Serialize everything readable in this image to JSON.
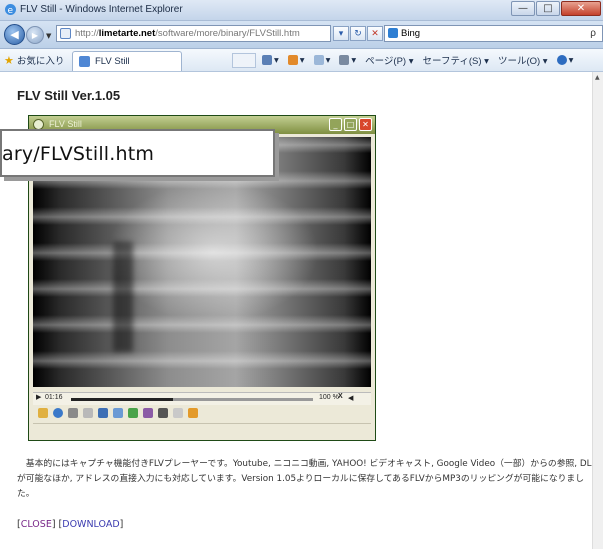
{
  "window": {
    "title": "FLV Still - Windows Internet Explorer",
    "min_label": "—",
    "max_label": "□",
    "close_label": "✕"
  },
  "address": {
    "url_prefix": "http://",
    "url_domain": "limetarte.net",
    "url_path": "/software/more/binary/FLVStill.htm",
    "dropdown_label": "▾",
    "refresh_label": "↻",
    "stop_label": "✕",
    "search_value": "Bing",
    "search_glyph": "ρ"
  },
  "favorites": {
    "fav_label": "お気に入り",
    "tab_title": "FLV Still"
  },
  "commands": [
    {
      "label": "▾",
      "color": "#5a7fb5"
    },
    {
      "label": "▾",
      "color": "#e28a2b"
    },
    {
      "label": "▾",
      "color": "#9bb7d8"
    },
    {
      "label": "▾",
      "color": "#7a8aa0"
    },
    {
      "label": "ページ(P) ▾",
      "color": ""
    },
    {
      "label": "セーフティ(S) ▾",
      "color": ""
    },
    {
      "label": "ツール(O) ▾",
      "color": ""
    },
    {
      "label": "▾",
      "color": "#2d6cc0"
    }
  ],
  "page": {
    "title": "FLV Still Ver.1.05",
    "description": "　基本的にはキャプチャ機能付きFLVプレーヤーです。Youtube, ニコニコ動画, YAHOO! ビデオキャスト, Google Video（一部）からの参照, DLが可能なほか, アドレスの直接入力にも対応しています。Version 1.05よりローカルに保存してあるFLVからMP3のリッピングが可能になりました。",
    "close_link": "CLOSE",
    "download_link": "DOWNLOAD"
  },
  "app": {
    "title": "FLV Still",
    "time": "01:16",
    "zoom": "100 %",
    "progress": 0.42
  },
  "tooltip": {
    "text": "ary/FLVStill.htm"
  },
  "colors": {
    "accent": "#2b5fa6",
    "app_title": "#7f8f41",
    "link": "#3b3bb0"
  }
}
